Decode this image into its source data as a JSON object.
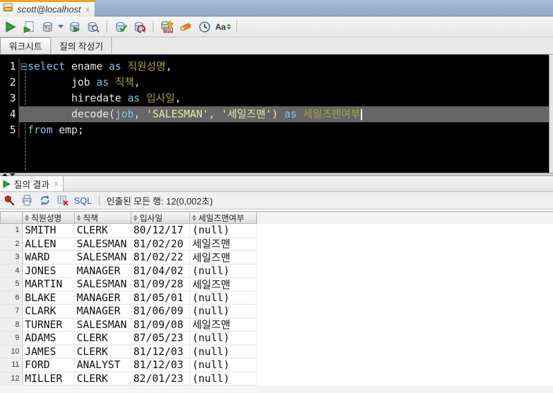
{
  "window": {
    "doc_tab": {
      "title": "scott@localhost",
      "close": "x"
    }
  },
  "main_toolbar": {
    "icons": [
      "run-statement",
      "run-script",
      "explain-plan",
      "explain-plan-dropdown",
      "autotrace",
      "sql-tuning-advisor",
      "commit",
      "rollback",
      "monitor-sql",
      "clear",
      "sql-history",
      "change-case"
    ],
    "monitor_sql_text": "SQL",
    "change_case_text": "Aa"
  },
  "editor_tabs": {
    "tabs": [
      {
        "label": "워크시트",
        "active": true
      },
      {
        "label": "질의 작성기",
        "active": false
      }
    ]
  },
  "editor": {
    "colors": {
      "background": "#000000",
      "keyword": "#85c3ea",
      "identifier": "#eaeaea",
      "alias": "#a6a345",
      "string": "#e9e6ab",
      "selected_line_bg": "#666666"
    },
    "lines": [
      {
        "num": "1",
        "fold": true,
        "segments": [
          {
            "t": "select",
            "s": "kw"
          },
          {
            "t": " ",
            "s": "pl"
          },
          {
            "t": "ename",
            "s": "id"
          },
          {
            "t": " ",
            "s": "pl"
          },
          {
            "t": "as",
            "s": "kw"
          },
          {
            "t": " ",
            "s": "pl"
          },
          {
            "t": "직원성명",
            "s": "al"
          },
          {
            "t": ",",
            "s": "id"
          }
        ]
      },
      {
        "num": "2",
        "segments": [
          {
            "t": "       ",
            "s": "pl"
          },
          {
            "t": "job",
            "s": "id"
          },
          {
            "t": " ",
            "s": "pl"
          },
          {
            "t": "as",
            "s": "kw"
          },
          {
            "t": " ",
            "s": "pl"
          },
          {
            "t": "직책",
            "s": "al"
          },
          {
            "t": ",",
            "s": "id"
          }
        ]
      },
      {
        "num": "3",
        "segments": [
          {
            "t": "       ",
            "s": "pl"
          },
          {
            "t": "hiredate",
            "s": "id"
          },
          {
            "t": " ",
            "s": "pl"
          },
          {
            "t": "as",
            "s": "kw"
          },
          {
            "t": " ",
            "s": "pl"
          },
          {
            "t": "입사일",
            "s": "al"
          },
          {
            "t": ",",
            "s": "id"
          }
        ]
      },
      {
        "num": "4",
        "selected": true,
        "cursor": true,
        "segments": [
          {
            "t": "       ",
            "s": "pl"
          },
          {
            "t": "decode(",
            "s": "id"
          },
          {
            "t": "job",
            "s": "kw"
          },
          {
            "t": ", ",
            "s": "id"
          },
          {
            "t": "'SALESMAN'",
            "s": "st"
          },
          {
            "t": ", ",
            "s": "id"
          },
          {
            "t": "'세일즈맨'",
            "s": "st"
          },
          {
            "t": ") ",
            "s": "id"
          },
          {
            "t": "as",
            "s": "kw"
          },
          {
            "t": " ",
            "s": "pl"
          },
          {
            "t": "세일즈맨여부",
            "s": "al"
          }
        ]
      },
      {
        "num": "5",
        "segments": [
          {
            "t": "from",
            "s": "kw"
          },
          {
            "t": " ",
            "s": "pl"
          },
          {
            "t": "emp;",
            "s": "id"
          }
        ]
      }
    ]
  },
  "results": {
    "tab": {
      "label": "질의 결과",
      "close": "x"
    },
    "toolbar": {
      "sql_label": "SQL",
      "status": "인출된 모든 행: 12(0,002초)"
    },
    "grid": {
      "columns": [
        "직원성명",
        "직책",
        "입사일",
        "세일즈맨여부"
      ],
      "rows": [
        [
          "1",
          "SMITH",
          "CLERK",
          "80/12/17",
          "(null)"
        ],
        [
          "2",
          "ALLEN",
          "SALESMAN",
          "81/02/20",
          "세일즈맨"
        ],
        [
          "3",
          "WARD",
          "SALESMAN",
          "81/02/22",
          "세일즈맨"
        ],
        [
          "4",
          "JONES",
          "MANAGER",
          "81/04/02",
          "(null)"
        ],
        [
          "5",
          "MARTIN",
          "SALESMAN",
          "81/09/28",
          "세일즈맨"
        ],
        [
          "6",
          "BLAKE",
          "MANAGER",
          "81/05/01",
          "(null)"
        ],
        [
          "7",
          "CLARK",
          "MANAGER",
          "81/06/09",
          "(null)"
        ],
        [
          "8",
          "TURNER",
          "SALESMAN",
          "81/09/08",
          "세일즈맨"
        ],
        [
          "9",
          "ADAMS",
          "CLERK",
          "87/05/23",
          "(null)"
        ],
        [
          "10",
          "JAMES",
          "CLERK",
          "81/12/03",
          "(null)"
        ],
        [
          "11",
          "FORD",
          "ANALYST",
          "81/12/03",
          "(null)"
        ],
        [
          "12",
          "MILLER",
          "CLERK",
          "82/01/23",
          "(null)"
        ]
      ]
    }
  },
  "accents": {
    "tab_highlight": "#f0a51c",
    "tabbar_background": "#97b2ce",
    "sql_link_blue": "#2d50c0",
    "pin_red": "#c32b2b",
    "run_green": "#2fa03c"
  }
}
